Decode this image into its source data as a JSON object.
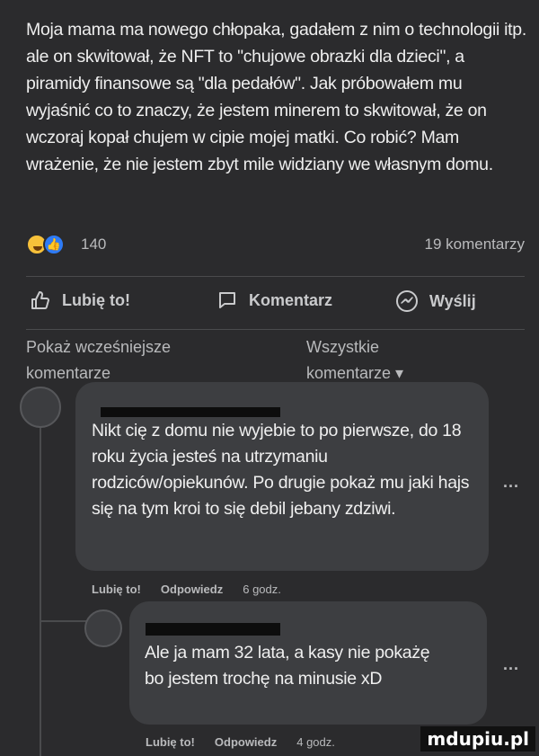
{
  "post": {
    "text": "Moja mama ma nowego chłopaka, gadałem z nim o technologii itp. ale on skwitował, że NFT to \"chujowe obrazki dla dzieci\", a piramidy finansowe są \"dla pedałów\". Jak próbowałem mu wyjaśnić co to znaczy, że jestem minerem to skwitował, że on wczoraj kopał chujem w cipie mojej matki. Co robić? Mam wrażenie, że nie jestem zbyt mile widziany we własnym domu.",
    "reaction_count": "140",
    "comment_count": "19 komentarzy"
  },
  "actions": {
    "like_label": "Lubię to!",
    "comment_label": "Komentarz",
    "send_label": "Wyślij"
  },
  "comments_header": {
    "show_earlier": "Pokaż wcześniejsze komentarze",
    "all_comments": "Wszystkie komentarze ▾"
  },
  "comments": [
    {
      "text": "Nikt cię z domu nie wyjebie to po pierwsze, do 18 roku życia jesteś na utrzymaniu rodziców/opiekunów. Po drugie pokaż mu jaki hajs się na tym kroi to się debil jebany zdziwi.",
      "like_label": "Lubię to!",
      "reply_label": "Odpowiedz",
      "time": "6 godz.",
      "more": "..."
    },
    {
      "text": "Ale ja mam 32 lata, a kasy nie pokażę bo jestem trochę na minusie xD",
      "like_label": "Lubię to!",
      "reply_label": "Odpowiedz",
      "time": "4 godz.",
      "more": "..."
    }
  ],
  "watermark": "mdupiu.pl",
  "colors": {
    "background": "#2b2b2d",
    "bubble": "#3d3e41",
    "like_blue": "#2e7bf6",
    "haha_yellow": "#f7c13a"
  }
}
